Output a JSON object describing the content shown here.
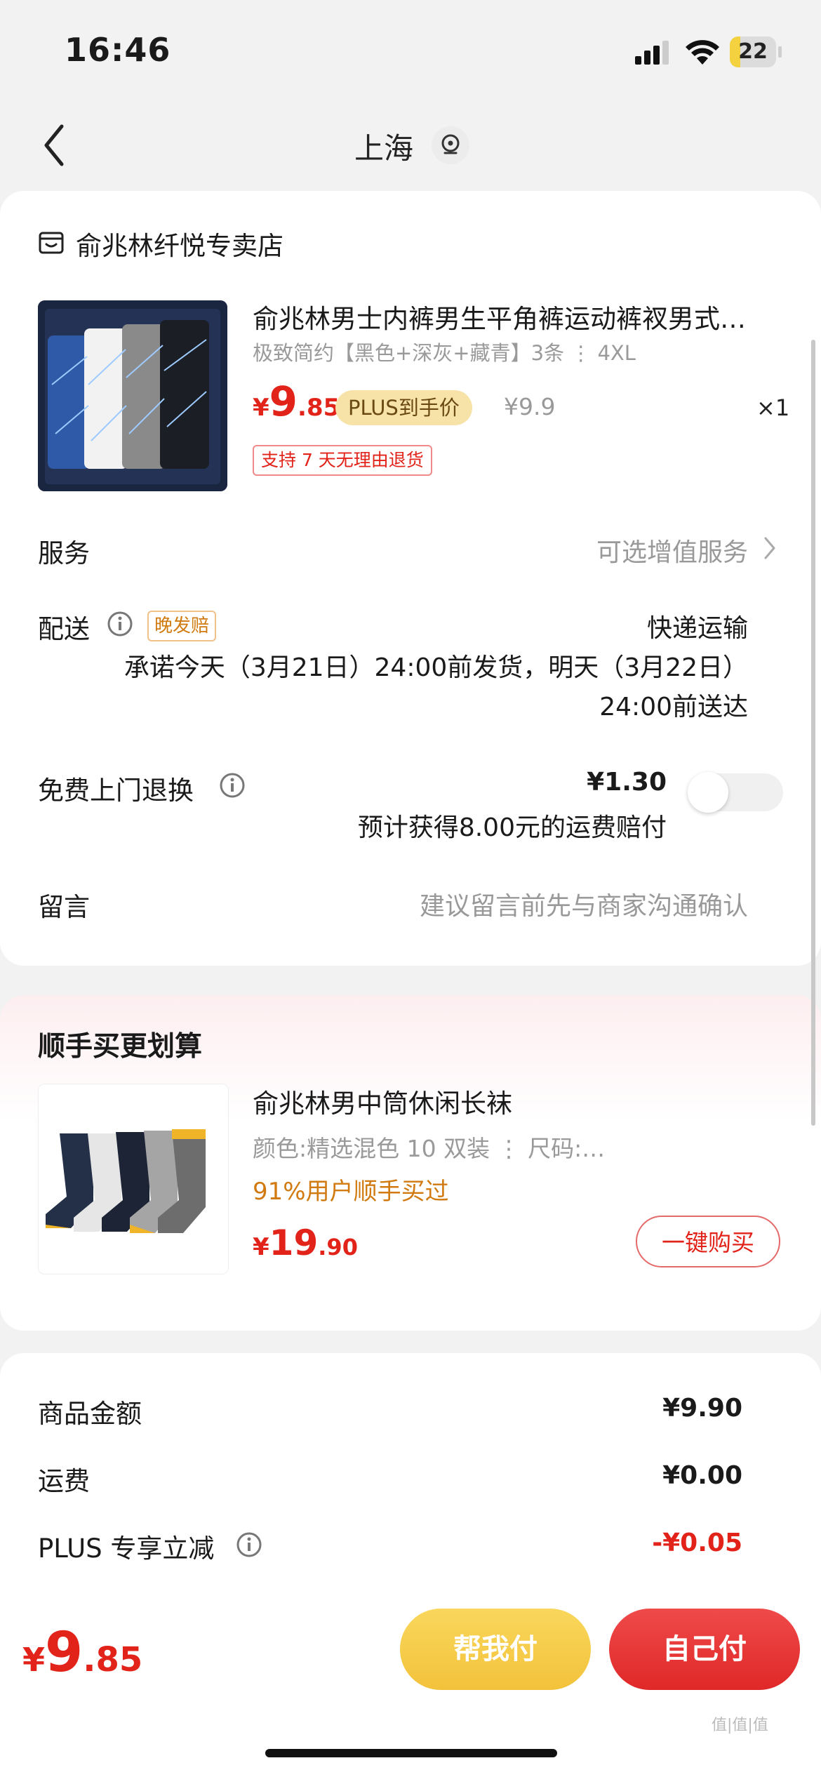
{
  "status_bar": {
    "time": "16:46",
    "battery": "22",
    "battery_level": 0.22
  },
  "header": {
    "title": "上海"
  },
  "store": {
    "name": "俞兆林纤悦专卖店"
  },
  "product": {
    "title": "俞兆林男士内裤男生平角裤运动裤衩男式…",
    "spec": "极致简约【黑色+深灰+藏青】3条 ⋮ 4XL",
    "price_currency": "¥",
    "price_int": "9",
    "price_dec": ".85",
    "plus_tag": "PLUS到手价",
    "original_price": "¥9.9",
    "quantity": "×1",
    "return_tag": "支持 7 天无理由退货"
  },
  "service": {
    "label": "服务",
    "value": "可选增值服务"
  },
  "delivery": {
    "label": "配送",
    "tag": "晚发赔",
    "method": "快递运输",
    "promise_line1": "承诺今天（3月21日）24:00前发货，明天（3月22日）",
    "promise_line2": "24:00前送达"
  },
  "free_return": {
    "label": "免费上门退换",
    "price": "¥1.30",
    "note": "预计获得8.00元的运费赔付",
    "enabled": false
  },
  "message": {
    "label": "留言",
    "placeholder": "建议留言前先与商家沟通确认"
  },
  "addon": {
    "section_title": "顺手买更划算",
    "title": "俞兆林男中筒休闲长袜",
    "spec": "颜色:精选混色 10 双装 ⋮ 尺码:…",
    "buyers": "91%用户顺手买过",
    "price_currency": "¥",
    "price_int": "19",
    "price_dec": ".90",
    "buy_label": "一键购买"
  },
  "summary": {
    "rows": [
      {
        "label": "商品金额",
        "value": "¥9.90",
        "color": "#1a1a1a"
      },
      {
        "label": "运费",
        "value": "¥0.00",
        "color": "#1a1a1a"
      },
      {
        "label": "PLUS 专享立减",
        "value": "-¥0.05",
        "color": "#e2231a"
      }
    ]
  },
  "footer": {
    "total_currency": "¥",
    "total_int": "9",
    "total_dec": ".85",
    "help_pay": "帮我付",
    "self_pay": "自己付"
  },
  "watermark": "值|值|值",
  "colors": {
    "accent": "#e2231a",
    "gold": "#f3c23b"
  }
}
